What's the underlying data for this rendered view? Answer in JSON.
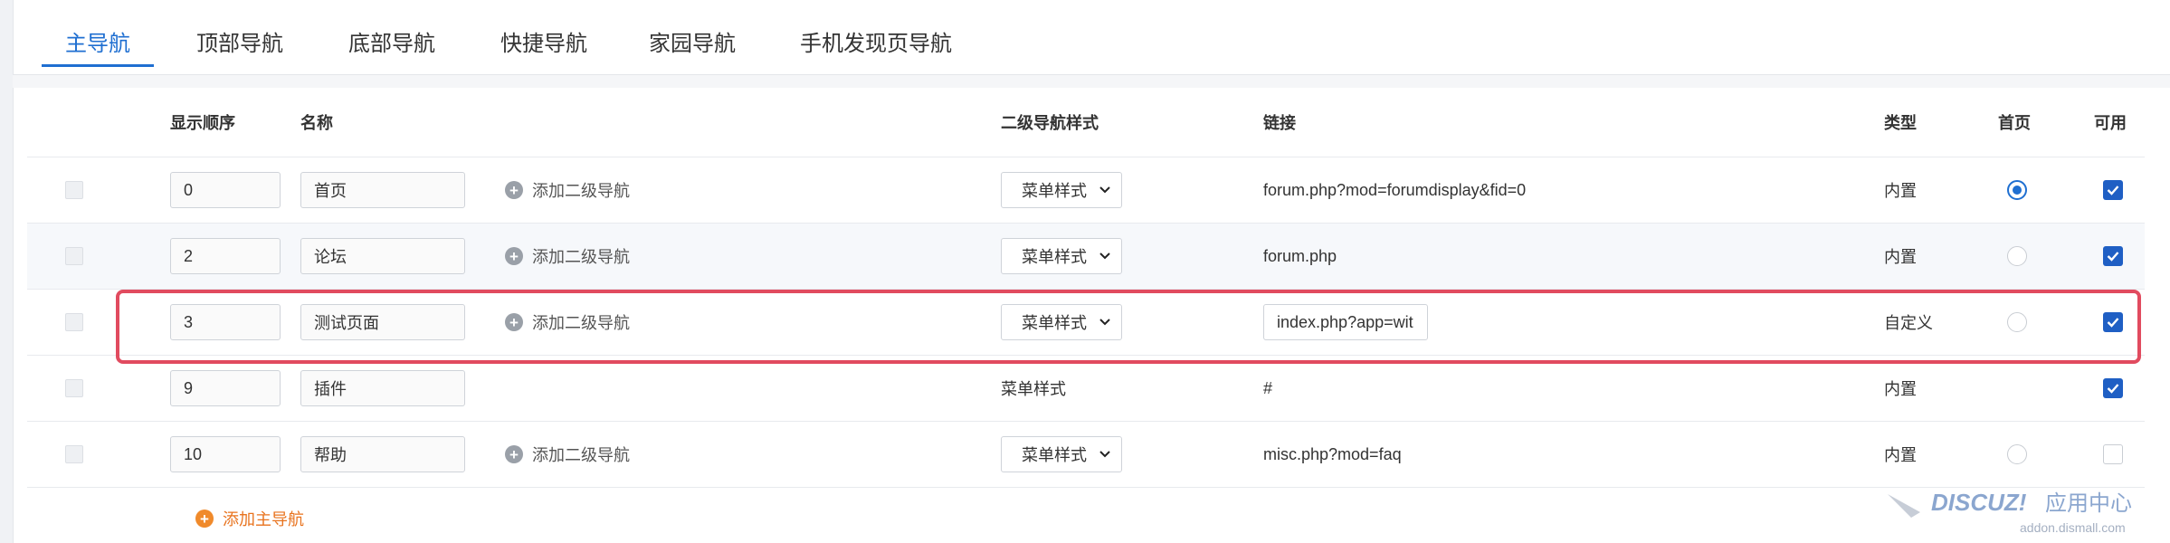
{
  "tabs": [
    {
      "label": "主导航",
      "active": true
    },
    {
      "label": "顶部导航",
      "active": false
    },
    {
      "label": "底部导航",
      "active": false
    },
    {
      "label": "快捷导航",
      "active": false
    },
    {
      "label": "家园导航",
      "active": false
    },
    {
      "label": "手机发现页导航",
      "active": false
    }
  ],
  "columns": {
    "order": "显示顺序",
    "name": "名称",
    "submenu_style": "二级导航样式",
    "link": "链接",
    "type": "类型",
    "home": "首页",
    "enabled": "可用"
  },
  "add_sub_label": "添加二级导航",
  "rows": [
    {
      "order": "0",
      "name": "首页",
      "has_add_sub": true,
      "style": "菜单样式",
      "style_is_select": true,
      "link": "forum.php?mod=forumdisplay&fid=0",
      "link_is_input": false,
      "type": "内置",
      "home": true,
      "enabled": true
    },
    {
      "order": "2",
      "name": "论坛",
      "has_add_sub": true,
      "style": "菜单样式",
      "style_is_select": true,
      "link": "forum.php",
      "link_is_input": false,
      "type": "内置",
      "home": false,
      "enabled": true
    },
    {
      "order": "3",
      "name": "测试页面",
      "has_add_sub": true,
      "style": "菜单样式",
      "style_is_select": true,
      "link": "index.php?app=wit",
      "link_is_input": true,
      "type": "自定义",
      "home": false,
      "enabled": true
    },
    {
      "order": "9",
      "name": "插件",
      "has_add_sub": false,
      "style": "菜单样式",
      "style_is_select": false,
      "link": "#",
      "link_is_input": false,
      "type": "内置",
      "home": null,
      "enabled": true
    },
    {
      "order": "10",
      "name": "帮助",
      "has_add_sub": true,
      "style": "菜单样式",
      "style_is_select": true,
      "link": "misc.php?mod=faq",
      "link_is_input": false,
      "type": "内置",
      "home": false,
      "enabled": false
    }
  ],
  "add_main_label": "添加主导航",
  "watermark": {
    "brand": "DISCUZ!",
    "cn": "应用中心",
    "url": "addon.dismall.com"
  },
  "colors": {
    "accent": "#1f6fd1",
    "highlight": "#e14b5f",
    "orange": "#e8731e"
  }
}
